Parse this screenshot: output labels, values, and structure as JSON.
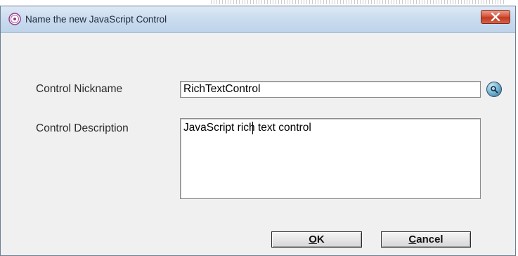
{
  "window": {
    "title": "Name the new JavaScript Control"
  },
  "form": {
    "nickname_label": "Control Nickname",
    "nickname_value": "RichTextControl",
    "description_label": "Control Description",
    "description_value": "JavaScript rich text control"
  },
  "buttons": {
    "ok": {
      "accel": "O",
      "rest": "K"
    },
    "cancel": {
      "accel": "C",
      "rest": "ancel"
    }
  },
  "icons": {
    "app": "app-logo-icon",
    "close": "close-icon",
    "lookup": "magnifier-icon"
  },
  "colors": {
    "titlebar": "#cbdcef",
    "close_button": "#d9563d",
    "dialog_background": "#f0f0f0"
  }
}
